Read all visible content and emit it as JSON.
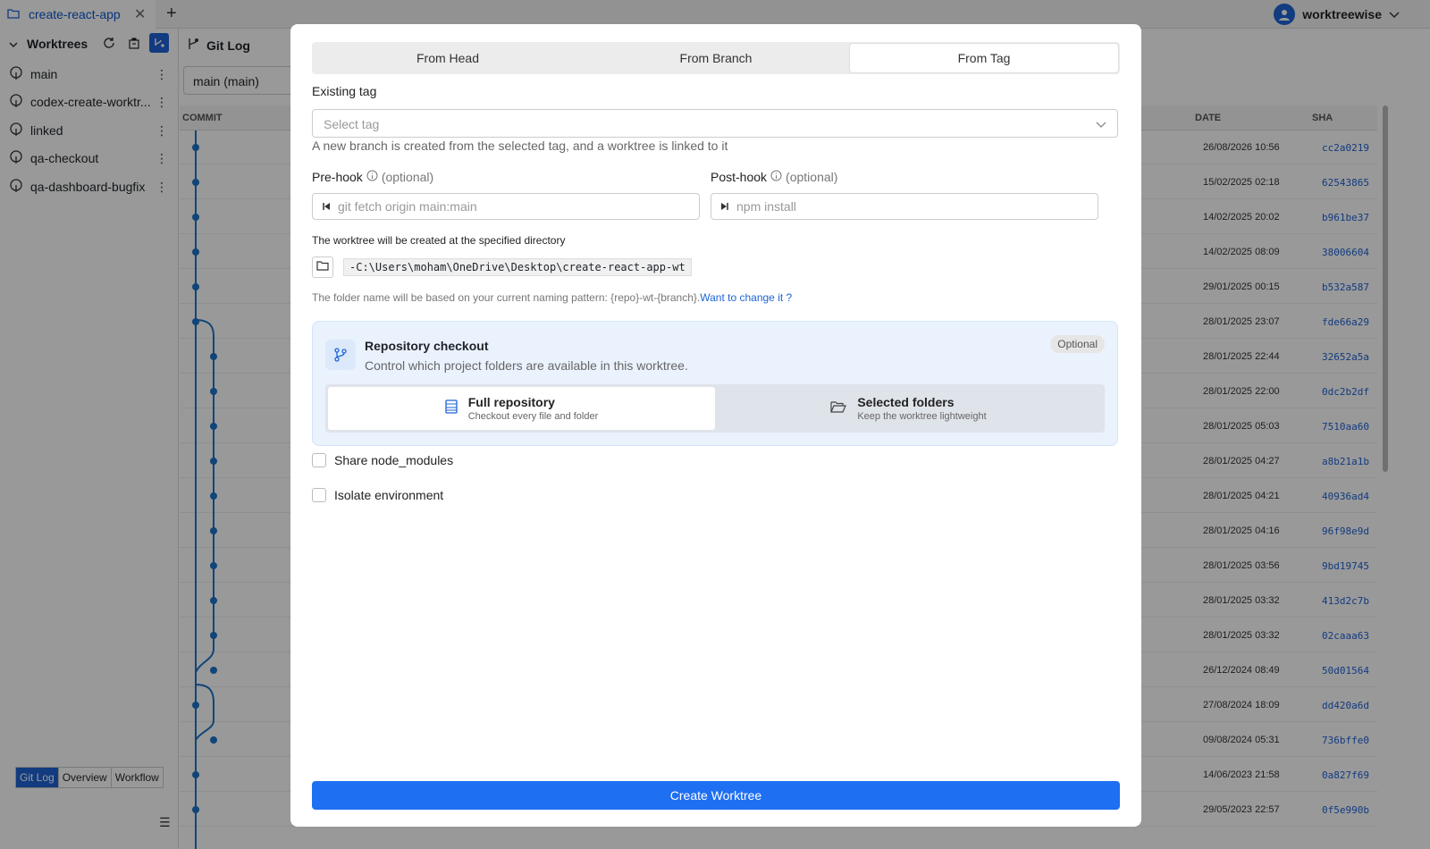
{
  "topbar": {
    "tab_label": "create-react-app",
    "user_name": "worktreewise"
  },
  "sidebar": {
    "title": "Worktrees",
    "items": [
      {
        "label": "main"
      },
      {
        "label": "codex-create-worktr..."
      },
      {
        "label": "linked"
      },
      {
        "label": "qa-checkout"
      },
      {
        "label": "qa-dashboard-bugfix"
      }
    ],
    "view_tabs": [
      "Git Log",
      "Overview",
      "Workflow"
    ]
  },
  "gitlog": {
    "title": "Git Log",
    "branch": "main (main)",
    "columns": {
      "commit": "COMMIT",
      "date": "DATE",
      "sha": "SHA"
    },
    "rows": [
      {
        "date": "26/08/2026 10:56",
        "sha": "cc2a0219"
      },
      {
        "date": "15/02/2025 02:18",
        "sha": "62543865"
      },
      {
        "date": "14/02/2025 20:02",
        "sha": "b961be37"
      },
      {
        "date": "14/02/2025 08:09",
        "sha": "38006604"
      },
      {
        "date": "29/01/2025 00:15",
        "sha": "b532a587"
      },
      {
        "date": "28/01/2025 23:07",
        "sha": "fde66a29"
      },
      {
        "date": "28/01/2025 22:44",
        "sha": "32652a5a"
      },
      {
        "date": "28/01/2025 22:00",
        "sha": "0dc2b2df"
      },
      {
        "date": "28/01/2025 05:03",
        "sha": "7510aa60"
      },
      {
        "date": "28/01/2025 04:27",
        "sha": "a8b21a1b"
      },
      {
        "date": "28/01/2025 04:21",
        "sha": "40936ad4"
      },
      {
        "date": "28/01/2025 04:16",
        "sha": "96f98e9d"
      },
      {
        "date": "28/01/2025 03:56",
        "sha": "9bd19745"
      },
      {
        "date": "28/01/2025 03:32",
        "sha": "413d2c7b"
      },
      {
        "date": "28/01/2025 03:32",
        "sha": "02caaa63"
      },
      {
        "date": "26/12/2024 08:49",
        "sha": "50d01564"
      },
      {
        "date": "27/08/2024 18:09",
        "sha": "dd420a6d"
      },
      {
        "date": "09/08/2024 05:31",
        "sha": "736bffe0"
      },
      {
        "date": "14/06/2023 21:58",
        "sha": "0a827f69"
      },
      {
        "date": "29/05/2023 22:57",
        "sha": "0f5e990b"
      }
    ]
  },
  "modal": {
    "tabs": [
      "From Head",
      "From Branch",
      "From Tag"
    ],
    "active_tab": "From Tag",
    "existing_tag_label": "Existing tag",
    "select_placeholder": "Select tag",
    "tag_hint": "A new branch is created from the selected tag, and a worktree is linked to it",
    "prehook_label": "Pre-hook",
    "posthook_label": "Post-hook",
    "optional": "(optional)",
    "prehook_placeholder": "git fetch origin main:main",
    "posthook_placeholder": "npm install",
    "dir_label": "The worktree will be created at the specified directory",
    "path": "-C:\\Users\\moham\\OneDrive\\Desktop\\create-react-app-wt",
    "naming_note": "The folder name will be based on your current naming pattern: {repo}-wt-{branch}.",
    "change_link": "Want to change it ?",
    "checkout": {
      "title": "Repository checkout",
      "desc": "Control which project folders are available in this worktree.",
      "badge": "Optional",
      "full_title": "Full repository",
      "full_sub": "Checkout every file and folder",
      "sel_title": "Selected folders",
      "sel_sub": "Keep the worktree lightweight"
    },
    "share_label": "Share node_modules",
    "isolate_label": "Isolate environment",
    "create_label": "Create Worktree"
  },
  "colors": {
    "accent": "#1e6ff2",
    "graph": "#1a73c8"
  }
}
